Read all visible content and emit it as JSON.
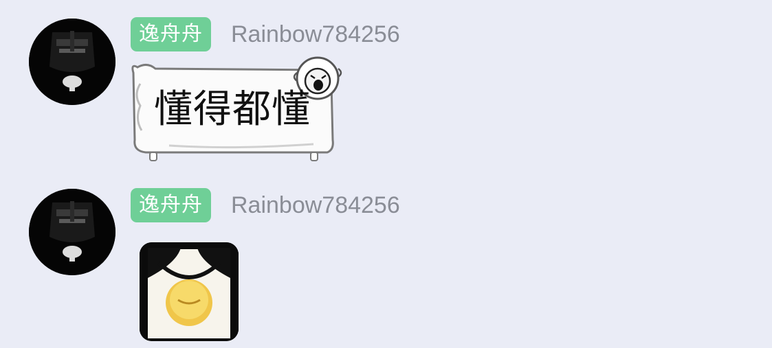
{
  "messages": [
    {
      "badge": "逸舟舟",
      "username": "Rainbow784256",
      "text": "懂得都懂",
      "bubble_style": "sheep-frame",
      "avatar_icon": "dark-figure-avatar"
    },
    {
      "badge": "逸舟舟",
      "username": "Rainbow784256",
      "sticker_icon": "emoji-sticker",
      "avatar_icon": "dark-figure-avatar"
    }
  ],
  "colors": {
    "background": "#eaecf6",
    "badge": "#6fcf97",
    "username": "#8a8d96"
  }
}
